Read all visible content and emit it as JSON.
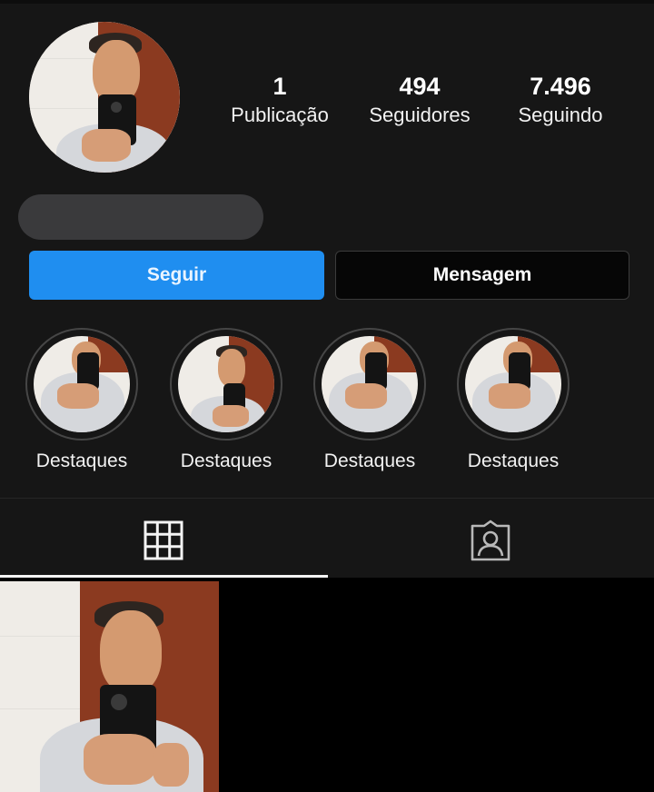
{
  "profile": {
    "stats": [
      {
        "value": "1",
        "label": "Publicação"
      },
      {
        "value": "494",
        "label": "Seguidores"
      },
      {
        "value": "7.496",
        "label": "Seguindo"
      }
    ]
  },
  "actions": {
    "follow_label": "Seguir",
    "message_label": "Mensagem"
  },
  "highlights": [
    {
      "label": "Destaques"
    },
    {
      "label": "Destaques"
    },
    {
      "label": "Destaques"
    },
    {
      "label": "Destaques"
    }
  ],
  "tabs": [
    {
      "icon": "grid-icon",
      "active": true
    },
    {
      "icon": "tagged-user-icon",
      "active": false
    }
  ],
  "colors": {
    "background": "#161616",
    "accent": "#1f8ef0",
    "grid_background": "#000000"
  }
}
